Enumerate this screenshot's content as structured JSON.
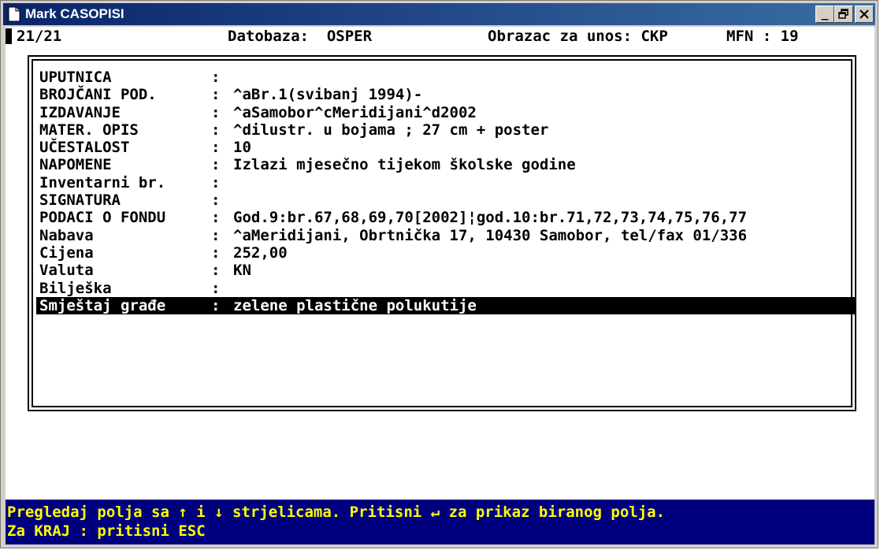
{
  "window": {
    "title": "Mark CASOPISI",
    "controls": {
      "minimize": "_",
      "restore": "🗗",
      "close": "✕"
    }
  },
  "status": {
    "record": "21/21",
    "database": "Datobaza:  OSPER",
    "form": "Obrazac za unos: CKP",
    "mfn": "MFN : 19"
  },
  "fields": [
    {
      "label": "UPUTNICA",
      "sep": ":",
      "value": ""
    },
    {
      "label": "BROJČANI POD.",
      "sep": ":",
      "value": "^aBr.1(svibanj 1994)-"
    },
    {
      "label": "IZDAVANJE",
      "sep": ":",
      "value": "^aSamobor^cMeridijani^d2002"
    },
    {
      "label": "MATER. OPIS",
      "sep": ":",
      "value": "^dilustr. u bojama ; 27 cm + poster"
    },
    {
      "label": "UČESTALOST",
      "sep": ":",
      "value": "10"
    },
    {
      "label": "NAPOMENE",
      "sep": ":",
      "value": "Izlazi mjesečno tijekom školske godine"
    },
    {
      "label": "Inventarni br.",
      "sep": ":",
      "value": ""
    },
    {
      "label": "SIGNATURA",
      "sep": ":",
      "value": ""
    },
    {
      "label": "PODACI O FONDU",
      "sep": ":",
      "value": "God.9:br.67,68,69,70[2002]¦god.10:br.71,72,73,74,75,76,77"
    },
    {
      "label": "Nabava",
      "sep": ":",
      "value": "^aMeridijani, Obrtnička 17, 10430 Samobor, tel/fax 01/336"
    },
    {
      "label": "Cijena",
      "sep": ":",
      "value": "252,00"
    },
    {
      "label": "Valuta",
      "sep": ":",
      "value": "KN"
    },
    {
      "label": "Bilješka",
      "sep": ":",
      "value": ""
    },
    {
      "label": "Smještaj građe",
      "sep": ":",
      "value": "zelene plastične polukutije"
    }
  ],
  "selected_index": 13,
  "help": {
    "line1": "Pregledaj polja sa ↑ i ↓ strjelicama. Pritisni ↵ za prikaz biranog polja.",
    "line2": "Za KRAJ : pritisni ESC"
  },
  "colors": {
    "title_bar": "#0a246a",
    "help_bg": "#00007f",
    "help_fg": "#ffff00",
    "selection_bg": "#000000",
    "selection_fg": "#ffffff"
  },
  "icons": {
    "app": "document-icon"
  }
}
